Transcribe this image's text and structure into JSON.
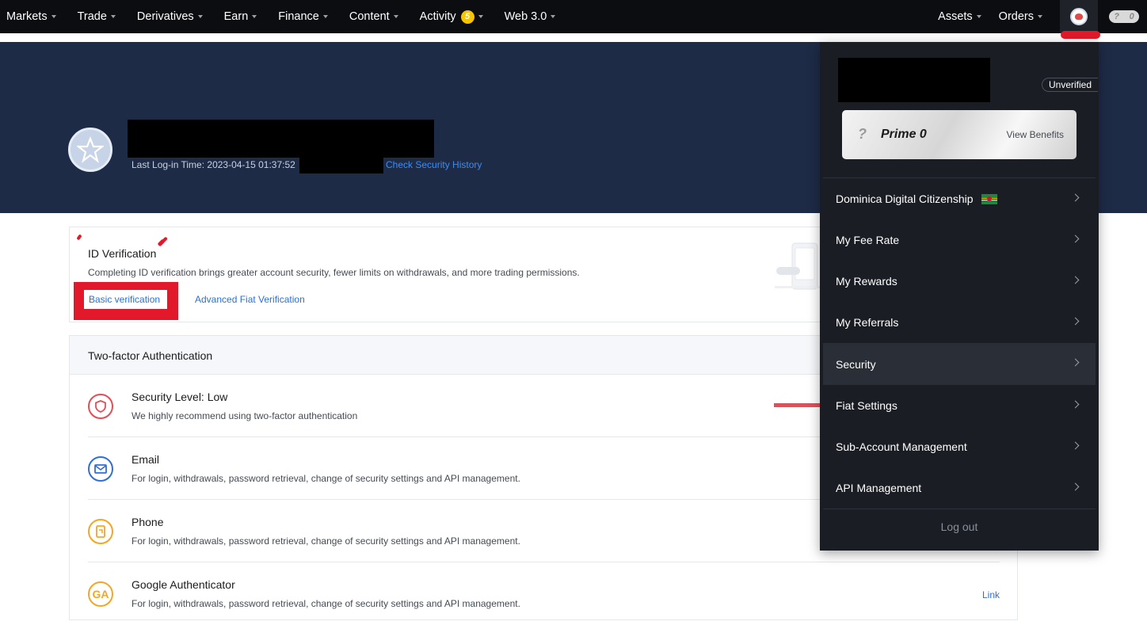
{
  "nav": {
    "left": [
      {
        "label": "Markets"
      },
      {
        "label": "Trade"
      },
      {
        "label": "Derivatives"
      },
      {
        "label": "Earn"
      },
      {
        "label": "Finance"
      },
      {
        "label": "Content"
      },
      {
        "label": "Activity",
        "badge": "5"
      },
      {
        "label": "Web 3.0"
      }
    ],
    "right": [
      {
        "label": "Assets"
      },
      {
        "label": "Orders"
      }
    ],
    "badge_count": "0"
  },
  "hero": {
    "last_login_label": "Last Log-in Time:",
    "last_login_time": "2023-04-15 01:37:52",
    "security_history_link": "Check Security History"
  },
  "id_verification": {
    "title": "ID Verification",
    "description": "Completing ID verification brings greater account security, fewer limits on withdrawals, and more trading permissions.",
    "basic_link": "Basic verification",
    "advanced_link": "Advanced Fiat Verification"
  },
  "two_factor": {
    "title": "Two-factor Authentication",
    "rows": [
      {
        "title": "Security Level: Low",
        "desc": "We highly recommend using two-factor authentication",
        "icon": "shield-icon"
      },
      {
        "title": "Email",
        "desc": "For login, withdrawals, password retrieval, change of security settings and API management.",
        "icon": "mail-icon"
      },
      {
        "title": "Phone",
        "desc": "For login, withdrawals, password retrieval, change of security settings and API management.",
        "icon": "phone-icon"
      },
      {
        "title": "Google Authenticator",
        "desc": "For login, withdrawals, password retrieval, change of security settings and API management.",
        "icon": "google-authenticator-icon",
        "action": "Link"
      }
    ],
    "ga_icon_text": "GA"
  },
  "dropdown": {
    "status": "Unverified",
    "prime_label": "Prime 0",
    "view_benefits": "View Benefits",
    "items": [
      {
        "label": "Dominica Digital Citizenship",
        "flag": true
      },
      {
        "label": "My Fee Rate"
      },
      {
        "label": "My Rewards"
      },
      {
        "label": "My Referrals"
      },
      {
        "label": "Security",
        "active": true
      },
      {
        "label": "Fiat Settings"
      },
      {
        "label": "Sub-Account Management"
      },
      {
        "label": "API Management"
      }
    ],
    "logout": "Log out"
  },
  "colors": {
    "nav_bg": "#0b0d11",
    "hero_bg": "#1e2b46",
    "dropdown_bg": "#1a1d24",
    "link": "#2c6fdc",
    "annotation_red": "#e1192a",
    "security_low": "#ea4b55",
    "email_blue": "#2f6fd6",
    "phone_orange": "#f5a623"
  }
}
